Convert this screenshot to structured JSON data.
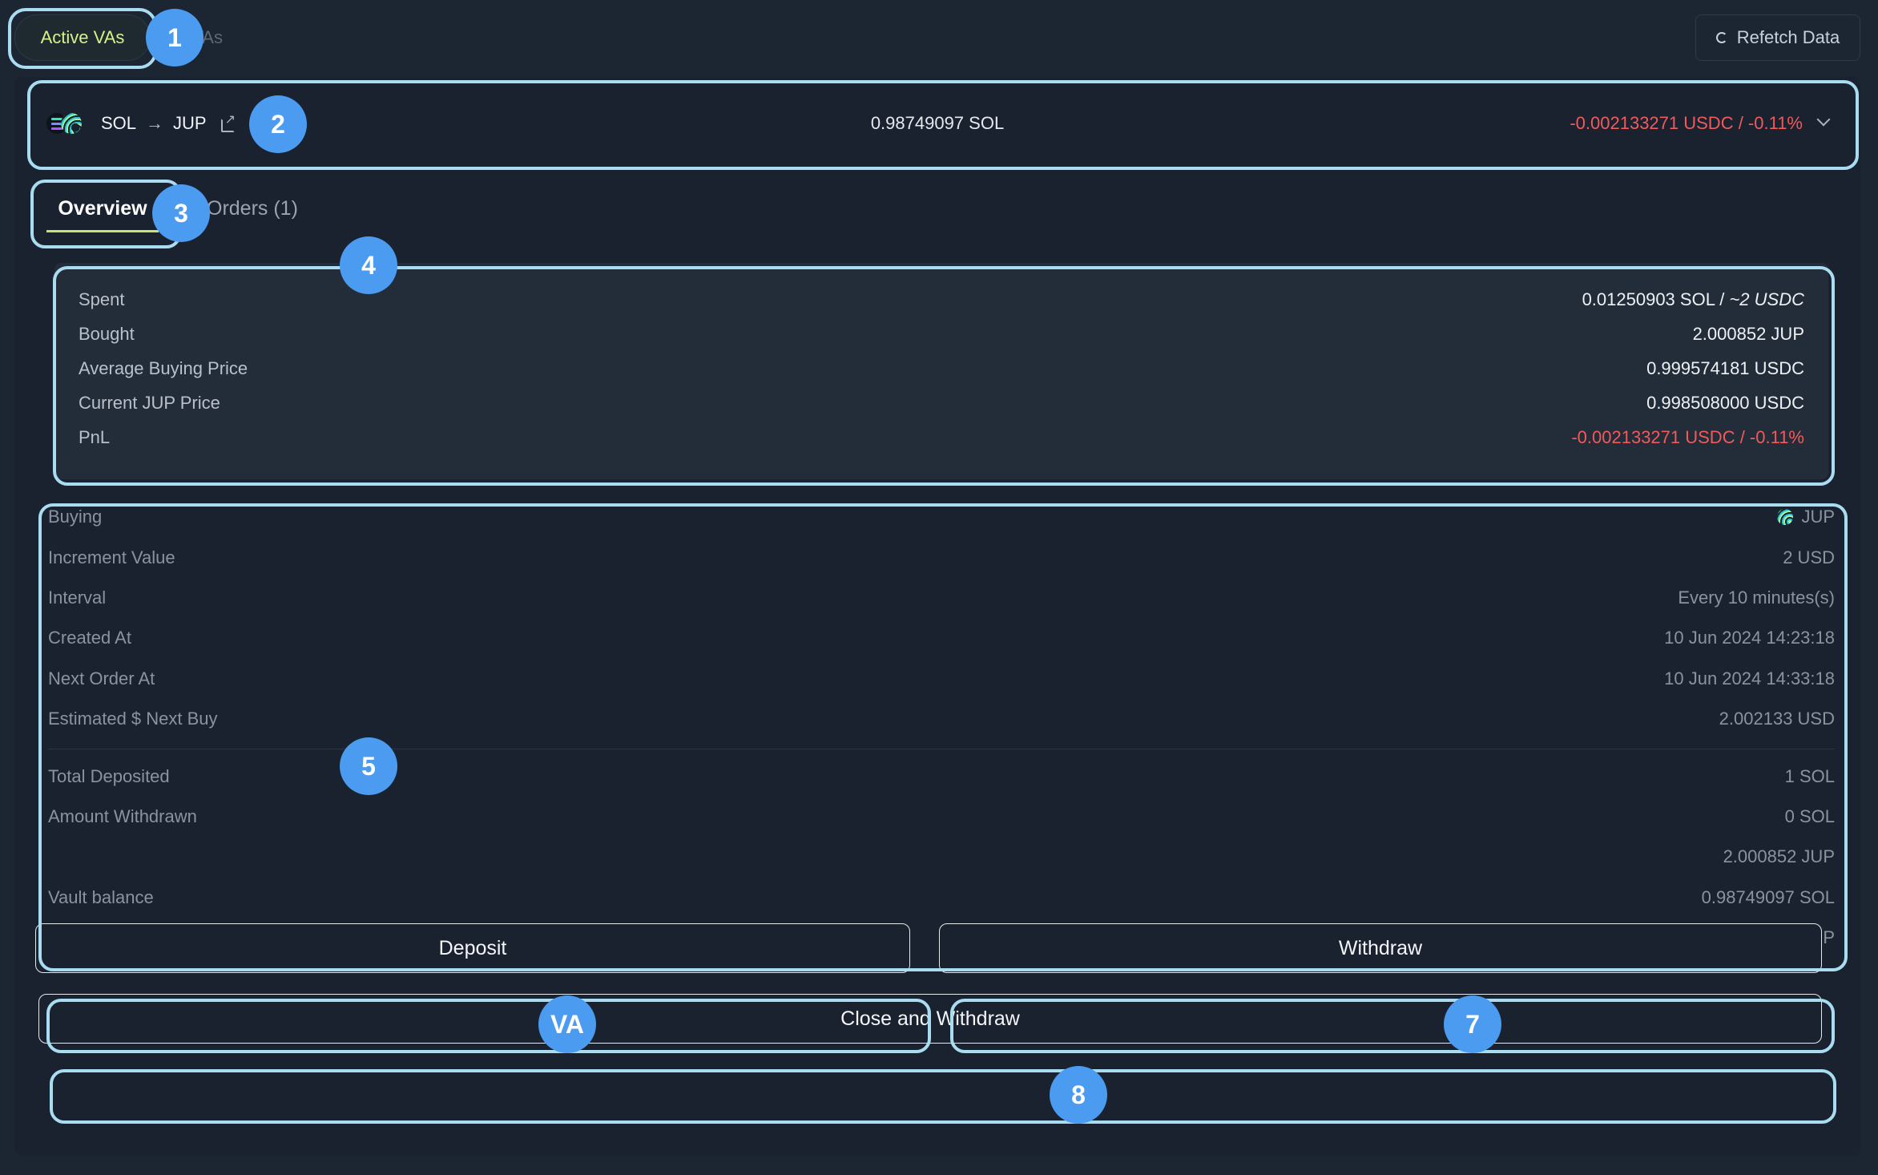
{
  "top_tabs": {
    "active_label": "Active VAs",
    "past_label": "st VAs",
    "refetch_label": "Refetch Data"
  },
  "pair": {
    "from": "SOL",
    "to": "JUP",
    "arrow": "→",
    "balance": "0.98749097 SOL",
    "pnl": "-0.002133271 USDC / -0.11%"
  },
  "sub_tabs": {
    "overview": "Overview",
    "orders": "Orders (1)"
  },
  "summary": {
    "rows": [
      {
        "label": "Spent",
        "value": "0.01250903 SOL / ",
        "value_italic": "~2 USDC"
      },
      {
        "label": "Bought",
        "value": "2.000852 JUP"
      },
      {
        "label": "Average Buying Price",
        "value": "0.999574181 USDC"
      },
      {
        "label": "Current JUP Price",
        "value": "0.998508000 USDC"
      },
      {
        "label": "PnL",
        "value": "-0.002133271 USDC / -0.11%"
      }
    ]
  },
  "details": {
    "top": [
      {
        "label": "Buying",
        "value": "JUP"
      },
      {
        "label": "Increment Value",
        "value": "2 USD"
      },
      {
        "label": "Interval",
        "value": "Every 10 minutes(s)"
      },
      {
        "label": "Created At",
        "value": "10 Jun 2024 14:23:18"
      },
      {
        "label": "Next Order At",
        "value": "10 Jun 2024 14:33:18"
      },
      {
        "label": "Estimated $ Next Buy",
        "value": "2.002133 USD"
      }
    ],
    "bottom": [
      {
        "label": "Total Deposited",
        "value": "1 SOL"
      },
      {
        "label": "Amount Withdrawn",
        "value": "0 SOL"
      },
      {
        "label": "",
        "value": "2.000852 JUP"
      },
      {
        "label": "Vault balance",
        "value": "0.98749097 SOL"
      },
      {
        "label": "",
        "value": "0 JUP"
      }
    ]
  },
  "buttons": {
    "deposit": "Deposit",
    "withdraw": "Withdraw",
    "close": "Close and Withdraw"
  },
  "annotations": [
    "1",
    "2",
    "3",
    "4",
    "5",
    "VA",
    "7",
    "8"
  ],
  "colors": {
    "accent_green": "#c9e36c",
    "negative_red": "#f25a5a",
    "annotation_blue": "#4b9bf0",
    "annotation_outline": "#a9dcf0"
  }
}
